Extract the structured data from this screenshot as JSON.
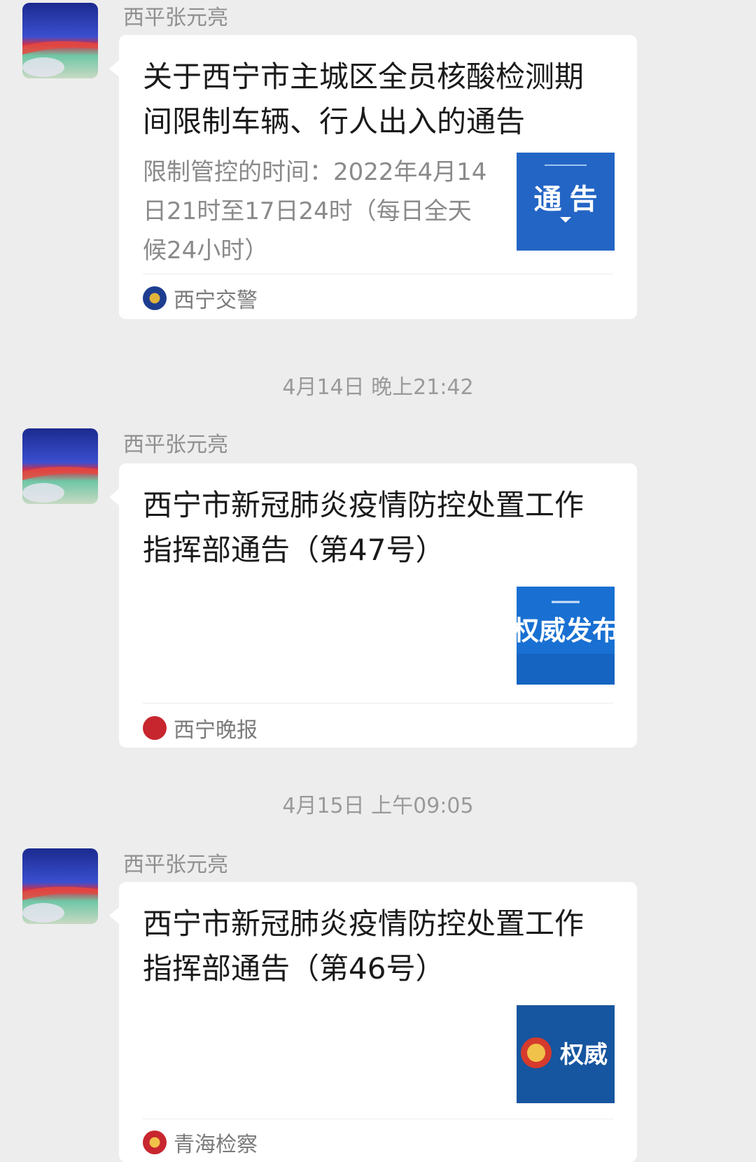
{
  "messages": [
    {
      "sender": "西平张元亮",
      "title": "关于西宁市主城区全员核酸检测期间限制车辆、行人出入的通告",
      "desc": "限制管控的时间：2022年4月14日21时至17日24时（每日全天候24小时）",
      "thumb_text": "通 告",
      "source": "西宁交警"
    },
    {
      "sender": "西平张元亮",
      "title": "西宁市新冠肺炎疫情防控处置工作指挥部通告（第47号）",
      "desc": "",
      "thumb_text": "权威发布",
      "source": "西宁晚报"
    },
    {
      "sender": "西平张元亮",
      "title": "西宁市新冠肺炎疫情防控处置工作指挥部通告（第46号）",
      "desc": "",
      "thumb_text": "权威",
      "source": "青海检察"
    }
  ],
  "timestamps": [
    "4月14日 晚上21:42",
    "4月15日 上午09:05"
  ],
  "colors": {
    "background": "#ededed",
    "card": "#ffffff",
    "thumb_blue": "#1a66c4",
    "thumb_navy": "#0f4fa0"
  }
}
